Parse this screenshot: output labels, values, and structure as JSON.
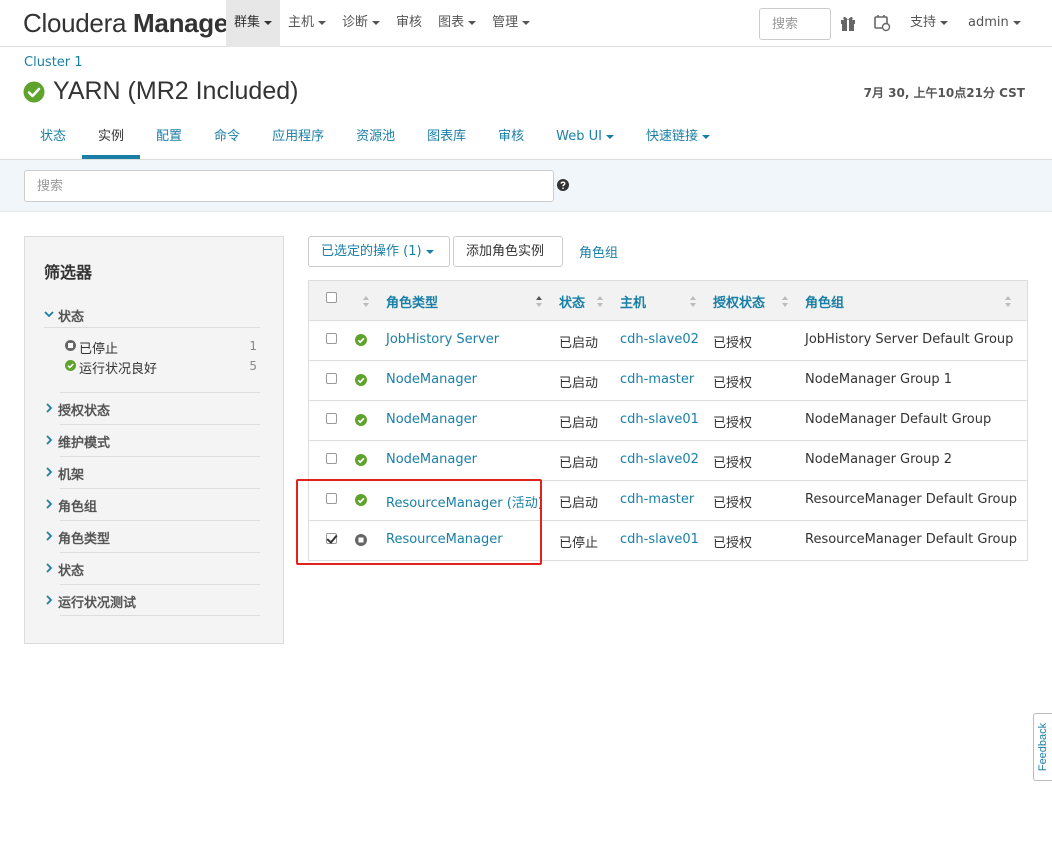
{
  "app": {
    "brand_light": "Cloudera ",
    "brand_bold": "Manager"
  },
  "topnav": {
    "menus": [
      {
        "label": "群集",
        "dropdown": true,
        "active": true
      },
      {
        "label": "主机",
        "dropdown": true
      },
      {
        "label": "诊断",
        "dropdown": true
      },
      {
        "label": "审核",
        "dropdown": false
      },
      {
        "label": "图表",
        "dropdown": true
      },
      {
        "label": "管理",
        "dropdown": true
      }
    ],
    "search_placeholder": "搜索",
    "support_label": "支持",
    "user_label": "admin"
  },
  "header": {
    "breadcrumb": "Cluster 1",
    "service_name": "YARN (MR2 Included)",
    "timestamp": "7月 30, 上午10点21分 CST"
  },
  "tabs": [
    {
      "label": "状态"
    },
    {
      "label": "实例",
      "active": true
    },
    {
      "label": "配置"
    },
    {
      "label": "命令"
    },
    {
      "label": "应用程序"
    },
    {
      "label": "资源池"
    },
    {
      "label": "图表库"
    },
    {
      "label": "审核"
    },
    {
      "label": "Web UI",
      "dropdown": true
    },
    {
      "label": "快速链接",
      "dropdown": true
    }
  ],
  "search": {
    "placeholder": "搜索"
  },
  "filters": {
    "title": "筛选器",
    "status_section": "状态",
    "status_items": [
      {
        "label": "已停止",
        "count": "1",
        "icon": "stopped-icon"
      },
      {
        "label": "运行状况良好",
        "count": "5",
        "icon": "good-health-icon"
      }
    ],
    "sections": [
      "授权状态",
      "维护模式",
      "机架",
      "角色组",
      "角色类型",
      "状态",
      "运行状况测试"
    ]
  },
  "actions": {
    "selected_ops_label": "已选定的操作 (1)",
    "add_role_label": "添加角色实例",
    "role_group_link": "角色组"
  },
  "table": {
    "columns": [
      "角色类型",
      "状态",
      "主机",
      "授权状态",
      "角色组"
    ],
    "rows": [
      {
        "checked": false,
        "health": "good",
        "role": "JobHistory Server",
        "state": "已启动",
        "host": "cdh-slave02",
        "auth": "已授权",
        "group": "JobHistory Server Default Group"
      },
      {
        "checked": false,
        "health": "good",
        "role": "NodeManager",
        "state": "已启动",
        "host": "cdh-master",
        "auth": "已授权",
        "group": "NodeManager Group 1"
      },
      {
        "checked": false,
        "health": "good",
        "role": "NodeManager",
        "state": "已启动",
        "host": "cdh-slave01",
        "auth": "已授权",
        "group": "NodeManager Default Group"
      },
      {
        "checked": false,
        "health": "good",
        "role": "NodeManager",
        "state": "已启动",
        "host": "cdh-slave02",
        "auth": "已授权",
        "group": "NodeManager Group 2"
      },
      {
        "checked": false,
        "health": "good",
        "role": "ResourceManager (活动)",
        "state": "已启动",
        "host": "cdh-master",
        "auth": "已授权",
        "group": "ResourceManager Default Group"
      },
      {
        "checked": true,
        "health": "stopped",
        "role": "ResourceManager",
        "state": "已停止",
        "host": "cdh-slave01",
        "auth": "已授权",
        "group": "ResourceManager Default Group"
      }
    ]
  },
  "feedback_label": "Feedback",
  "colors": {
    "link": "#1a7fa6",
    "good": "#5ea32b",
    "stopped": "#666666",
    "highlight": "#e0231c"
  }
}
